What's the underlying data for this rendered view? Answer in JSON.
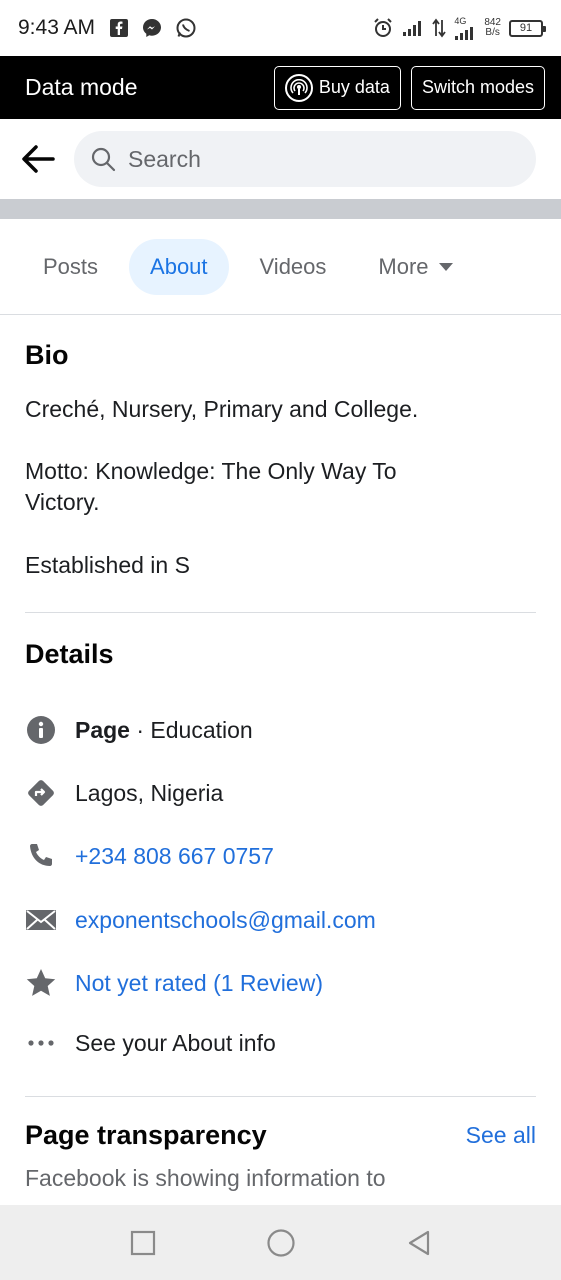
{
  "status_bar": {
    "time": "9:43 AM",
    "network_type": "4G",
    "speed_value": "842",
    "speed_unit": "B/s",
    "battery": "91"
  },
  "data_mode": {
    "title": "Data mode",
    "buy_label": "Buy data",
    "switch_label": "Switch modes"
  },
  "search": {
    "placeholder": "Search"
  },
  "tabs": [
    {
      "label": "Posts",
      "active": false
    },
    {
      "label": "About",
      "active": true
    },
    {
      "label": "Videos",
      "active": false
    },
    {
      "label": "More",
      "active": false
    }
  ],
  "bio": {
    "heading": "Bio",
    "line1": "Creché, Nursery, Primary and College.",
    "line2": "Motto: Knowledge: The Only Way To",
    "line3": "Victory.",
    "line4": "Established in S"
  },
  "details": {
    "heading": "Details",
    "page_label": "Page",
    "page_category": " · Education",
    "location": "Lagos, Nigeria",
    "phone": "+234 808 667 0757",
    "email": "exponentschools@gmail.com",
    "rating": "Not yet rated (1 Review)",
    "about_info": "See your About info"
  },
  "page_transparency": {
    "heading": "Page transparency",
    "see_all": "See all",
    "description": "Facebook is showing information to"
  },
  "colors": {
    "link": "#216fdb",
    "active_tab_bg": "#e7f3ff",
    "data_bar": "#000000"
  }
}
